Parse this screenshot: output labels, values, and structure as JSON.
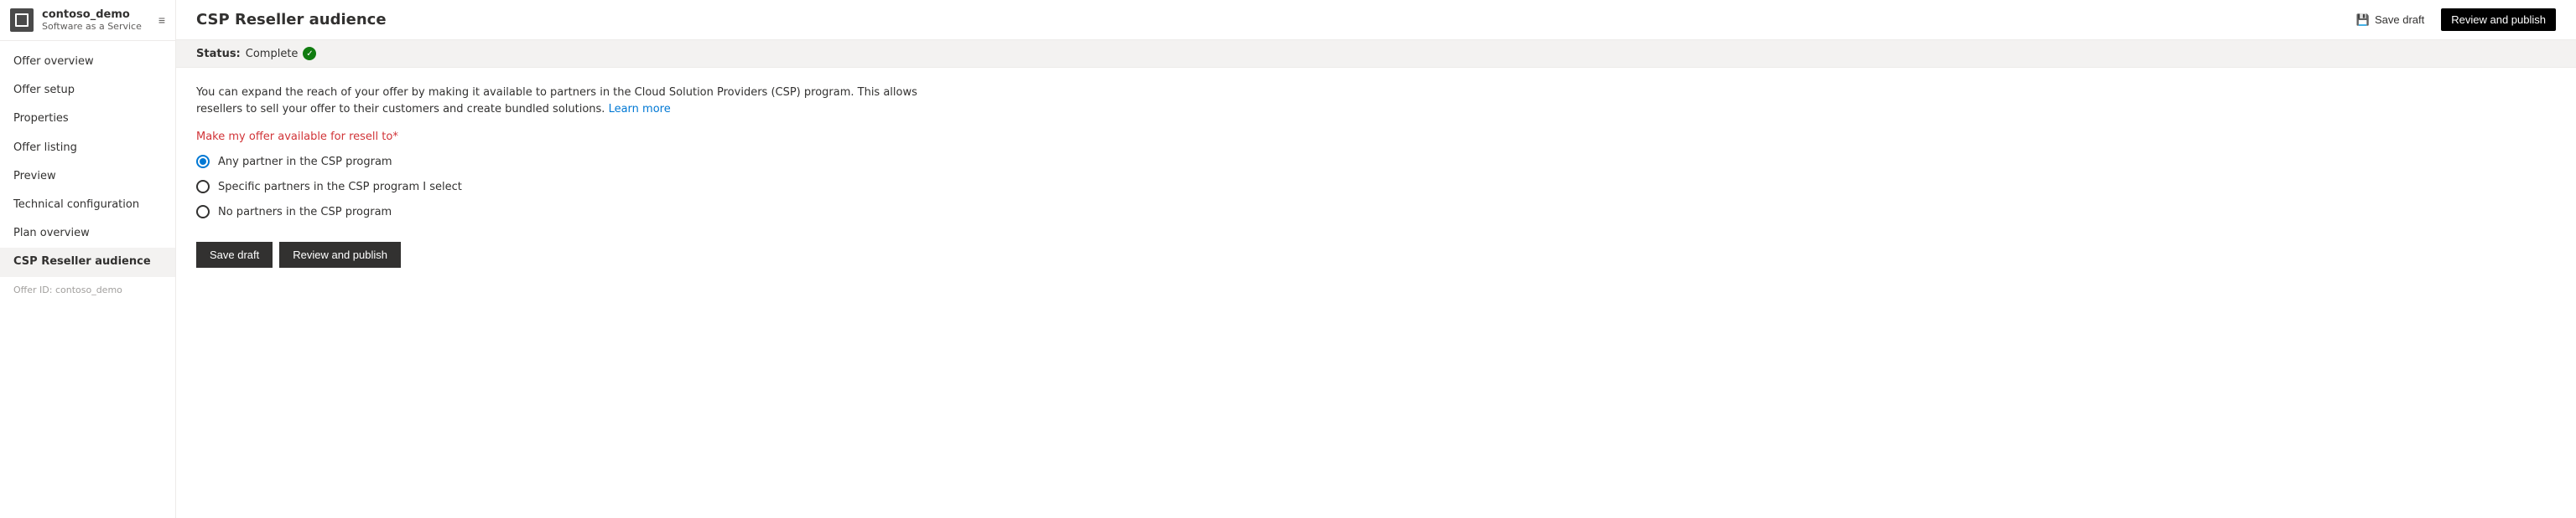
{
  "sidebar": {
    "app_name": "contoso_demo",
    "app_sub": "Software as a Service",
    "expand_icon": "≡",
    "items": [
      {
        "id": "offer-overview",
        "label": "Offer overview",
        "active": false
      },
      {
        "id": "offer-setup",
        "label": "Offer setup",
        "active": false
      },
      {
        "id": "properties",
        "label": "Properties",
        "active": false
      },
      {
        "id": "offer-listing",
        "label": "Offer listing",
        "active": false
      },
      {
        "id": "preview",
        "label": "Preview",
        "active": false
      },
      {
        "id": "technical-configuration",
        "label": "Technical configuration",
        "active": false
      },
      {
        "id": "plan-overview",
        "label": "Plan overview",
        "active": false
      },
      {
        "id": "csp-reseller-audience",
        "label": "CSP Reseller audience",
        "active": true
      },
      {
        "id": "offer-id",
        "label": "Offer ID: contoso_demo",
        "active": false,
        "type": "offer-id"
      }
    ]
  },
  "header": {
    "title": "CSP Reseller audience",
    "save_draft_label": "Save draft",
    "review_publish_label": "Review and publish"
  },
  "status": {
    "label": "Status:",
    "value": "Complete",
    "icon": "✓"
  },
  "content": {
    "description": "You can expand the reach of your offer by making it available to partners in the Cloud Solution Providers (CSP) program. This allows resellers to sell your offer to their customers and create bundled solutions.",
    "learn_more_label": "Learn more",
    "section_label": "Make my offer available for resell to",
    "required_marker": "*",
    "radio_options": [
      {
        "id": "any-partner",
        "label": "Any partner in the CSP program",
        "checked": true
      },
      {
        "id": "specific-partners",
        "label": "Specific partners in the CSP program I select",
        "checked": false
      },
      {
        "id": "no-partners",
        "label": "No partners in the CSP program",
        "checked": false
      }
    ],
    "save_draft_btn": "Save draft",
    "review_publish_btn": "Review and publish"
  }
}
